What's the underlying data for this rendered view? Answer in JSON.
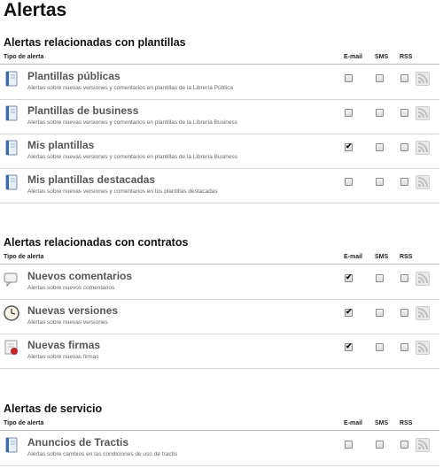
{
  "page": {
    "title": "Alertas"
  },
  "columns": {
    "type": "Tipo de alerta",
    "email": "E-mail",
    "sms": "SMS",
    "rss": "RSS"
  },
  "sections": [
    {
      "title": "Alertas relacionadas con plantillas",
      "rows": [
        {
          "name": "Plantillas públicas",
          "desc": "Alertas sobre nuevas versiones y comentarios en plantillas de la Librería Pública",
          "icon": "book-icon",
          "email": false,
          "sms": false,
          "rss": false
        },
        {
          "name": "Plantillas de business",
          "desc": "Alertas sobre nuevas versiones y comentarios en plantillas de la Librería Business",
          "icon": "book-icon",
          "email": false,
          "sms": false,
          "rss": false
        },
        {
          "name": "Mis plantillas",
          "desc": "Alertas sobre nuevas versiones y comentarios en plantillas de la Librería Business",
          "icon": "book-icon",
          "email": true,
          "sms": false,
          "rss": false
        },
        {
          "name": "Mis plantillas destacadas",
          "desc": "Alertas sobre nuevas versiones y comentarios en tus plantillas destacadas",
          "icon": "book-icon",
          "email": false,
          "sms": false,
          "rss": false
        }
      ]
    },
    {
      "title": "Alertas relacionadas con contratos",
      "rows": [
        {
          "name": "Nuevos comentarios",
          "desc": "Alertas sobre nuevos comentarios",
          "icon": "comment-icon",
          "email": true,
          "sms": false,
          "rss": false
        },
        {
          "name": "Nuevas versiones",
          "desc": "Alertas sobre nuevas versiones",
          "icon": "clock-icon",
          "email": true,
          "sms": false,
          "rss": false
        },
        {
          "name": "Nuevas firmas",
          "desc": "Alertas sobre nuevas firmas",
          "icon": "seal-icon",
          "email": true,
          "sms": false,
          "rss": false
        }
      ]
    },
    {
      "title": "Alertas de servicio",
      "rows": [
        {
          "name": "Anuncios de Tractis",
          "desc": "Alertas sobre cambios en las condiciones de uso de tractis",
          "icon": "book-icon",
          "email": false,
          "sms": false,
          "rss": false
        }
      ]
    }
  ],
  "colors": {
    "rss_icon": "#bdbdbd",
    "book_blue": "#3b6aa8"
  }
}
